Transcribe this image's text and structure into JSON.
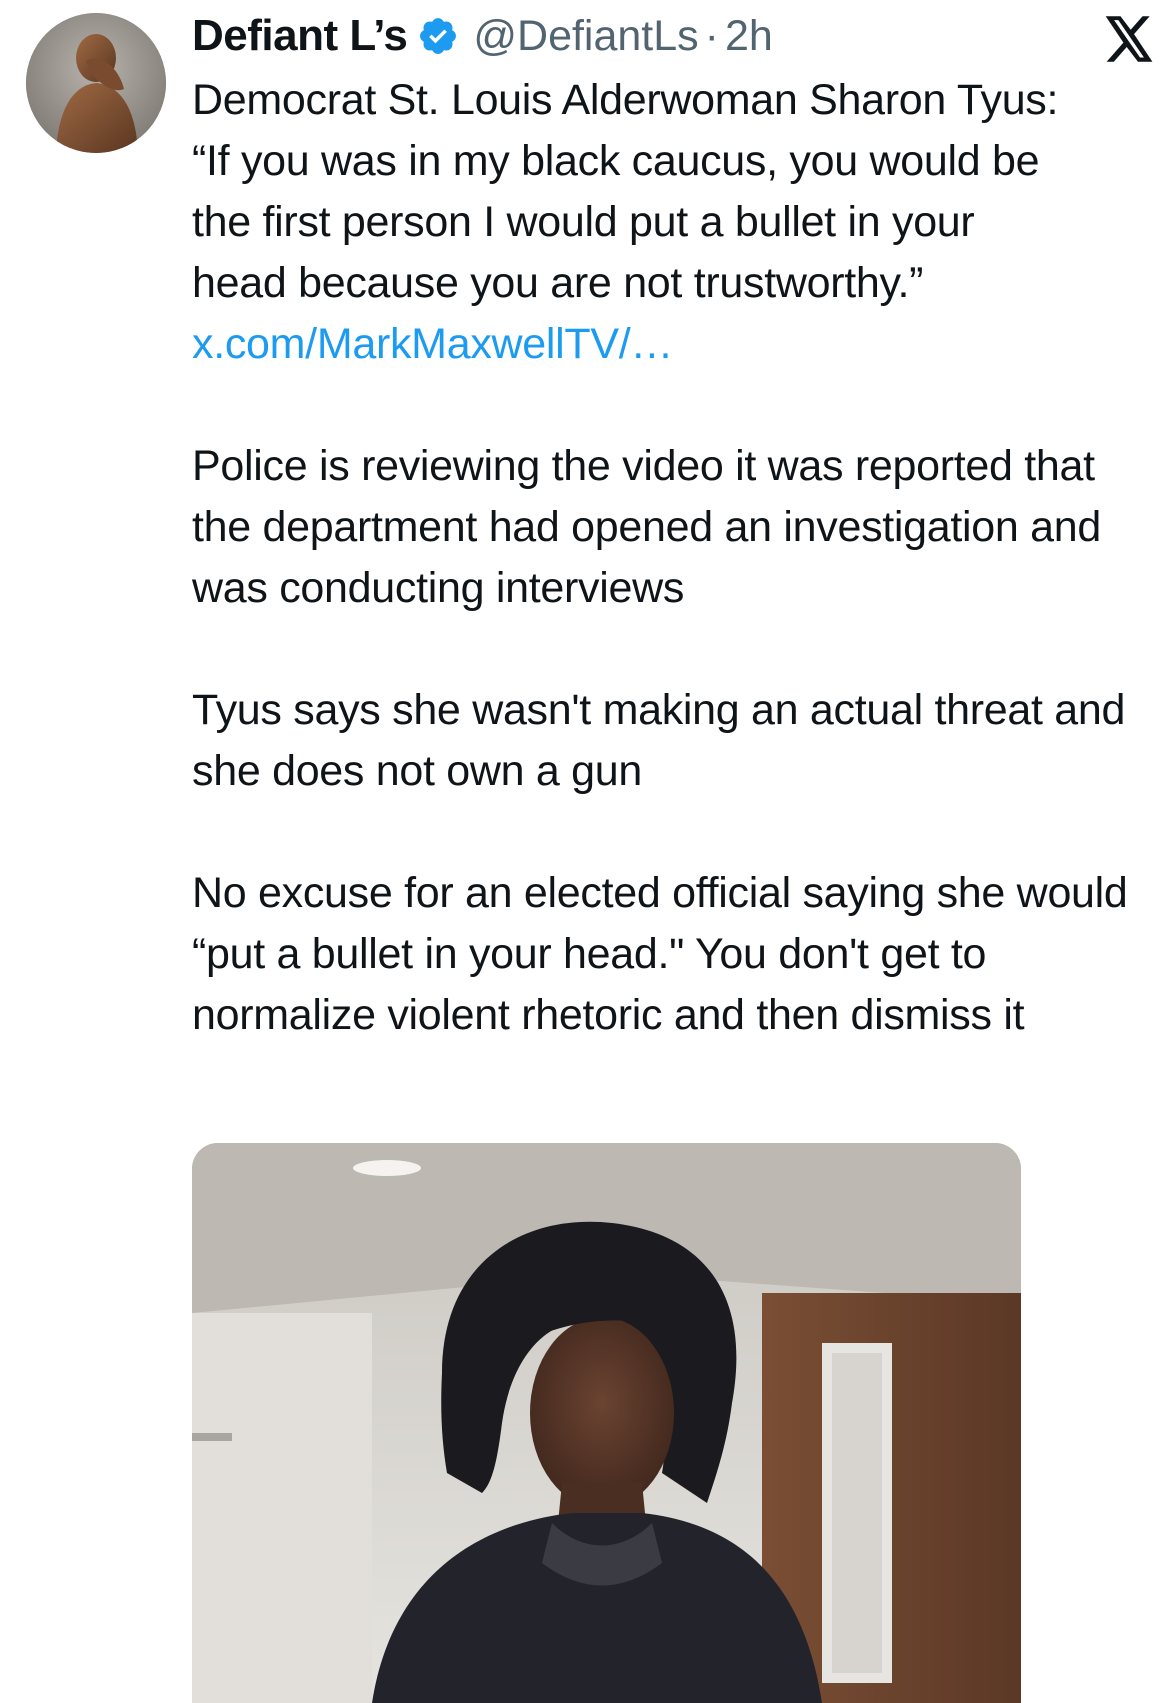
{
  "tweet": {
    "author_name": "Defiant L’s",
    "verified_icon": "verified-badge-icon",
    "handle": "@DefiantLs",
    "separator": "·",
    "time": "2h",
    "platform_logo": "x-logo-icon",
    "text_line_1": "Democrat St. Louis Alderwoman Sharon Tyus:",
    "text_line_2": "“If you was in my black caucus, you would be",
    "text_line_3": "the first person I would put a bullet in your",
    "text_line_4": "head because you are not trustworthy.”",
    "link": "x.com/MarkMaxwellTV/…",
    "paragraph_2": "Police is reviewing the video it was reported that the department had opened an investigation and was conducting interviews",
    "paragraph_3": "Tyus says she wasn't making an actual threat and she does not own a gun",
    "paragraph_4": "No excuse for an elected official saying she would “put a bullet in your head.\" You don't get to normalize violent rhetoric and then dismiss it"
  },
  "colors": {
    "text": "#0f1419",
    "secondary_text": "#536471",
    "link": "#1d9bf0",
    "verified": "#1d9bf0"
  }
}
